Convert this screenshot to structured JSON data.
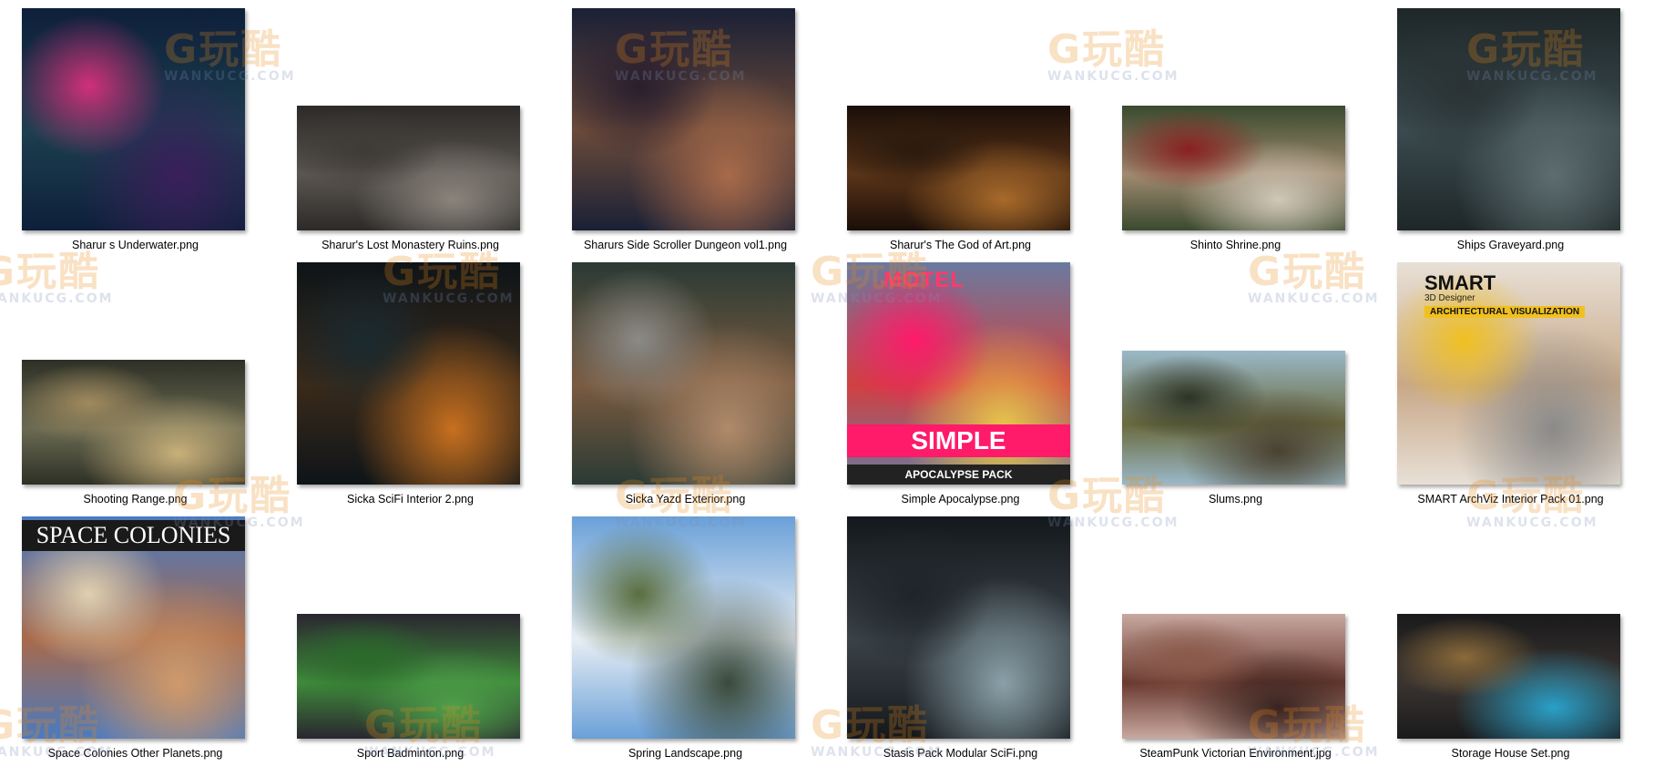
{
  "watermark": {
    "logo": "G玩酷",
    "site": "WANKUCG.COM"
  },
  "files": [
    {
      "name": "Sharur s Underwater.png",
      "overlay": "",
      "colors": [
        "#0e1f3a",
        "#1c3f4f",
        "#3a1f5a",
        "#d0307a"
      ]
    },
    {
      "name": "Sharur's Lost Monastery Ruins.png",
      "overlay": "",
      "colors": [
        "#2c2a28",
        "#5a5550",
        "#8a847c",
        "#3e3a36"
      ]
    },
    {
      "name": "Sharurs Side Scroller Dungeon vol1.png",
      "overlay": "",
      "colors": [
        "#1a2036",
        "#6a4a3a",
        "#a86a4a",
        "#2a1e2e"
      ]
    },
    {
      "name": "Sharur's The God of Art.png",
      "overlay": "",
      "colors": [
        "#1a0e08",
        "#5a3418",
        "#a86a2a",
        "#2a1a0e"
      ]
    },
    {
      "name": "Shinto Shrine.png",
      "overlay": "",
      "colors": [
        "#3a4a2e",
        "#a08a70",
        "#d0c8b8",
        "#8a2020"
      ]
    },
    {
      "name": "Ships Graveyard.png",
      "overlay": "",
      "colors": [
        "#1e2628",
        "#3a4a4e",
        "#5e6e70",
        "#2a3234"
      ]
    },
    {
      "name": "Shooting Range.png",
      "overlay": "",
      "colors": [
        "#2e3026",
        "#6a6a52",
        "#c8b07a",
        "#a08a5e"
      ]
    },
    {
      "name": "Sicka SciFi Interior 2.png",
      "overlay": "",
      "colors": [
        "#0e1418",
        "#3a2a1a",
        "#c8701e",
        "#1a2a30"
      ]
    },
    {
      "name": "Sicka Yazd Exterior.png",
      "overlay": "",
      "colors": [
        "#2a3a34",
        "#7a5a40",
        "#b08a6a",
        "#8a8a86"
      ]
    },
    {
      "name": "Simple Apocalypse.png",
      "overlay": "SIMPLE",
      "overlay2": "APOCALYPSE PACK",
      "overlay3": "MOTEL",
      "colors": [
        "#6a7aa0",
        "#d04040",
        "#e8c84a",
        "#ff1a6a"
      ]
    },
    {
      "name": "Slums.png",
      "overlay": "",
      "colors": [
        "#9ab8c8",
        "#6a6a3e",
        "#4a4232",
        "#2e3426"
      ]
    },
    {
      "name": "SMART ArchViz Interior Pack 01.png",
      "overlay": "SMART",
      "overlay2": "ARCHITECTURAL VISUALIZATION",
      "overlay3": "3D Designer",
      "colors": [
        "#e8e0d6",
        "#c8a888",
        "#8a8a8a",
        "#f0c020"
      ]
    },
    {
      "name": "Space Colonies Other Planets.png",
      "overlay": "SPACE COLONIES",
      "colors": [
        "#4a7ac0",
        "#a86a4a",
        "#d09a6a",
        "#e0d0b0"
      ]
    },
    {
      "name": "Sport Badminton.png",
      "overlay": "",
      "colors": [
        "#2a2630",
        "#3e8a3a",
        "#4ea04a",
        "#2a6a2a"
      ]
    },
    {
      "name": "Spring Landscape.png",
      "overlay": "",
      "colors": [
        "#6aa0d8",
        "#e8eef4",
        "#3a4a3a",
        "#5a6e3e"
      ]
    },
    {
      "name": "Stasis Pack Modular SciFi.png",
      "overlay": "",
      "colors": [
        "#14181c",
        "#3a4248",
        "#8aa0a8",
        "#1e2428"
      ]
    },
    {
      "name": "SteamPunk  Victorian Environment.jpg",
      "overlay": "",
      "colors": [
        "#c8a8a0",
        "#6a3a30",
        "#3a2420",
        "#8a5a4a"
      ]
    },
    {
      "name": "Storage House Set.png",
      "overlay": "",
      "colors": [
        "#1a1a1c",
        "#3a3430",
        "#2aa0c8",
        "#8a6a3a"
      ]
    }
  ]
}
